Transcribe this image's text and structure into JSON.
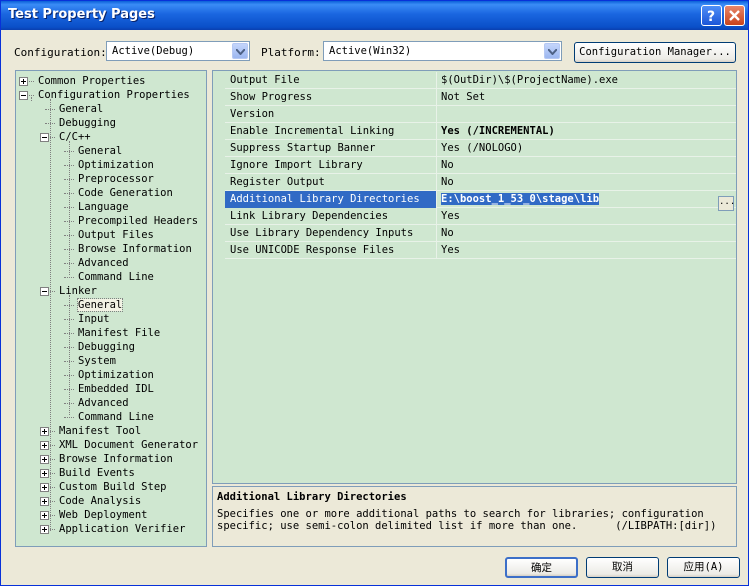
{
  "window": {
    "title": "Test Property Pages"
  },
  "toolbar": {
    "configuration_label": "Configuration:",
    "configuration_value": "Active(Debug)",
    "platform_label": "Platform:",
    "platform_value": "Active(Win32)",
    "config_manager_label": "Configuration Manager..."
  },
  "tree": {
    "common_properties": "Common Properties",
    "configuration_properties": "Configuration Properties",
    "general": "General",
    "debugging": "Debugging",
    "cpp": "C/C++",
    "cpp_items": [
      "General",
      "Optimization",
      "Preprocessor",
      "Code Generation",
      "Language",
      "Precompiled Headers",
      "Output Files",
      "Browse Information",
      "Advanced",
      "Command Line"
    ],
    "linker": "Linker",
    "linker_items": [
      "General",
      "Input",
      "Manifest File",
      "Debugging",
      "System",
      "Optimization",
      "Embedded IDL",
      "Advanced",
      "Command Line"
    ],
    "collapsed": [
      "Manifest Tool",
      "XML Document Generator",
      "Browse Information",
      "Build Events",
      "Custom Build Step",
      "Code Analysis",
      "Web Deployment",
      "Application Verifier"
    ]
  },
  "properties": [
    {
      "name": "Output File",
      "value": "$(OutDir)\\$(ProjectName).exe"
    },
    {
      "name": "Show Progress",
      "value": "Not Set"
    },
    {
      "name": "Version",
      "value": ""
    },
    {
      "name": "Enable Incremental Linking",
      "value": "Yes (/INCREMENTAL)"
    },
    {
      "name": "Suppress Startup Banner",
      "value": "Yes (/NOLOGO)"
    },
    {
      "name": "Ignore Import Library",
      "value": "No"
    },
    {
      "name": "Register Output",
      "value": "No"
    },
    {
      "name": "Additional Library Directories",
      "value": "E:\\boost_1_53_0\\stage\\lib"
    },
    {
      "name": "Link Library Dependencies",
      "value": "Yes"
    },
    {
      "name": "Use Library Dependency Inputs",
      "value": "No"
    },
    {
      "name": "Use UNICODE Response Files",
      "value": "Yes"
    }
  ],
  "description": {
    "title": "Additional Library Directories",
    "line1": "Specifies one or more additional paths to search for libraries; configuration",
    "line2": "specific; use semi-colon delimited list if more than one.      (/LIBPATH:[dir])"
  },
  "buttons": {
    "ok": "确定",
    "cancel": "取消",
    "apply": "应用(A)"
  },
  "colors": {
    "accent": "#316ac5",
    "panel_bg": "#cfe7d0",
    "title_bar": "#0a5fd8"
  }
}
